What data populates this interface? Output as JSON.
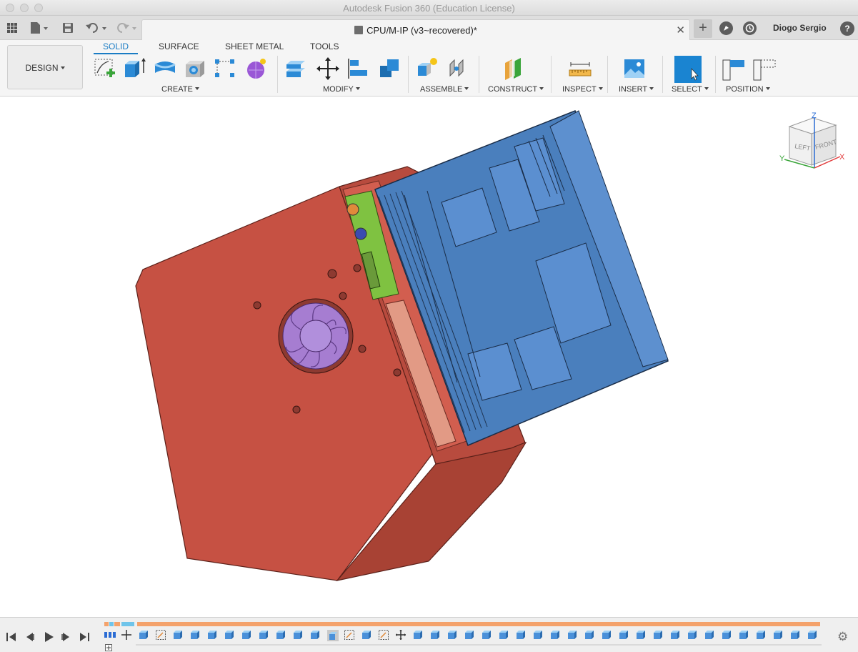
{
  "window": {
    "title": "Autodesk Fusion 360 (Education License)"
  },
  "document": {
    "tab_title": "CPU/M-IP (v3~recovered)*",
    "close_glyph": "✕"
  },
  "user": {
    "name": "Diogo Sergio",
    "help_glyph": "?"
  },
  "icons": {
    "grid": "grid-icon",
    "file": "file-icon",
    "save": "save-icon",
    "undo": "undo-icon",
    "redo": "redo-icon",
    "plus": "+"
  },
  "workspace": {
    "label": "DESIGN"
  },
  "tabs": [
    {
      "label": "SOLID",
      "active": true
    },
    {
      "label": "SURFACE",
      "active": false
    },
    {
      "label": "SHEET METAL",
      "active": false
    },
    {
      "label": "TOOLS",
      "active": false
    }
  ],
  "groups": {
    "create": "CREATE",
    "modify": "MODIFY",
    "assemble": "ASSEMBLE",
    "construct": "CONSTRUCT",
    "inspect": "INSPECT",
    "insert": "INSERT",
    "select": "SELECT",
    "position": "POSITION"
  },
  "viewcube": {
    "axis_z": "Z",
    "axis_x": "X",
    "axis_y": "Y",
    "face_left": "LEFT",
    "face_front": "FRONT"
  },
  "colors": {
    "accent": "#1a7cc4",
    "enclosure": "#c65143",
    "board": "#4a7fbd",
    "fan": "#a67dd1",
    "pcb_green": "#7fc241",
    "timeline_feature": "#4a90d9",
    "timeline_bar": "#f4a26b"
  },
  "timeline": {
    "settings_icon": "⚙"
  }
}
